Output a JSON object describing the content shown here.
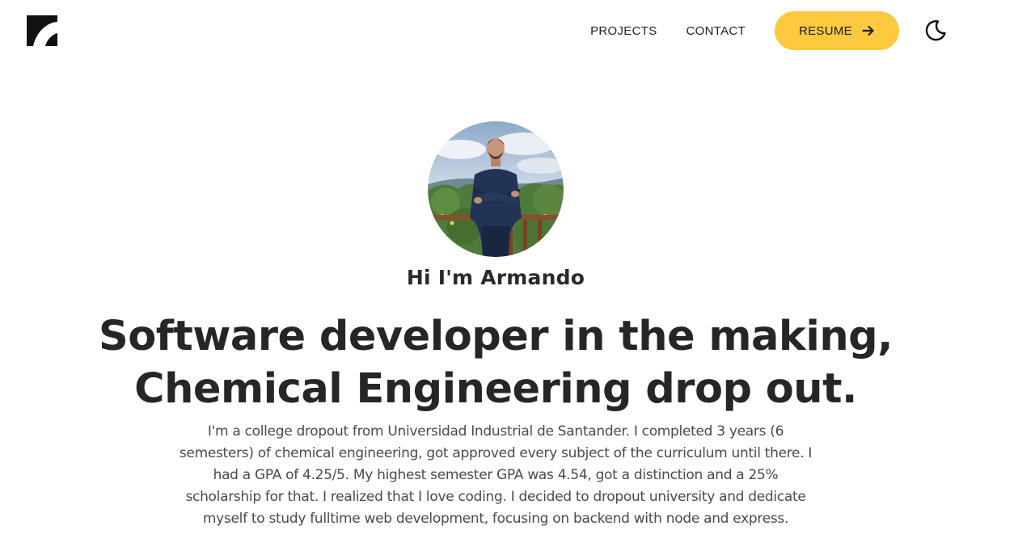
{
  "header": {
    "logo_icon": "brand-logo-icon",
    "nav": {
      "projects_label": "PROJECTS",
      "contact_label": "CONTACT",
      "resume_label": "RESUME",
      "resume_icon": "arrow-right-icon",
      "theme_icon": "moon-icon"
    }
  },
  "hero": {
    "avatar_alt": "avatar-photo",
    "greeting": "Hi I'm Armando",
    "headline_line1": "Software developer in the making,",
    "headline_line2": "Chemical Engineering drop out.",
    "bio": "I'm a college dropout from Universidad Industrial de Santander. I completed 3 years (6 semesters) of chemical engineering, got approved every subject of the curriculum until there. I had a GPA of 4.25/5. My highest semester GPA was 4.54, got a distinction and a 25% scholarship for that. I realized that I love coding. I decided to dropout university and dedicate myself to study fulltime web development, focusing on backend with node and express."
  },
  "colors": {
    "accent": "#fcc93f",
    "text_dark": "#262626",
    "text_body": "#4a4a4a",
    "background": "#ffffff"
  }
}
